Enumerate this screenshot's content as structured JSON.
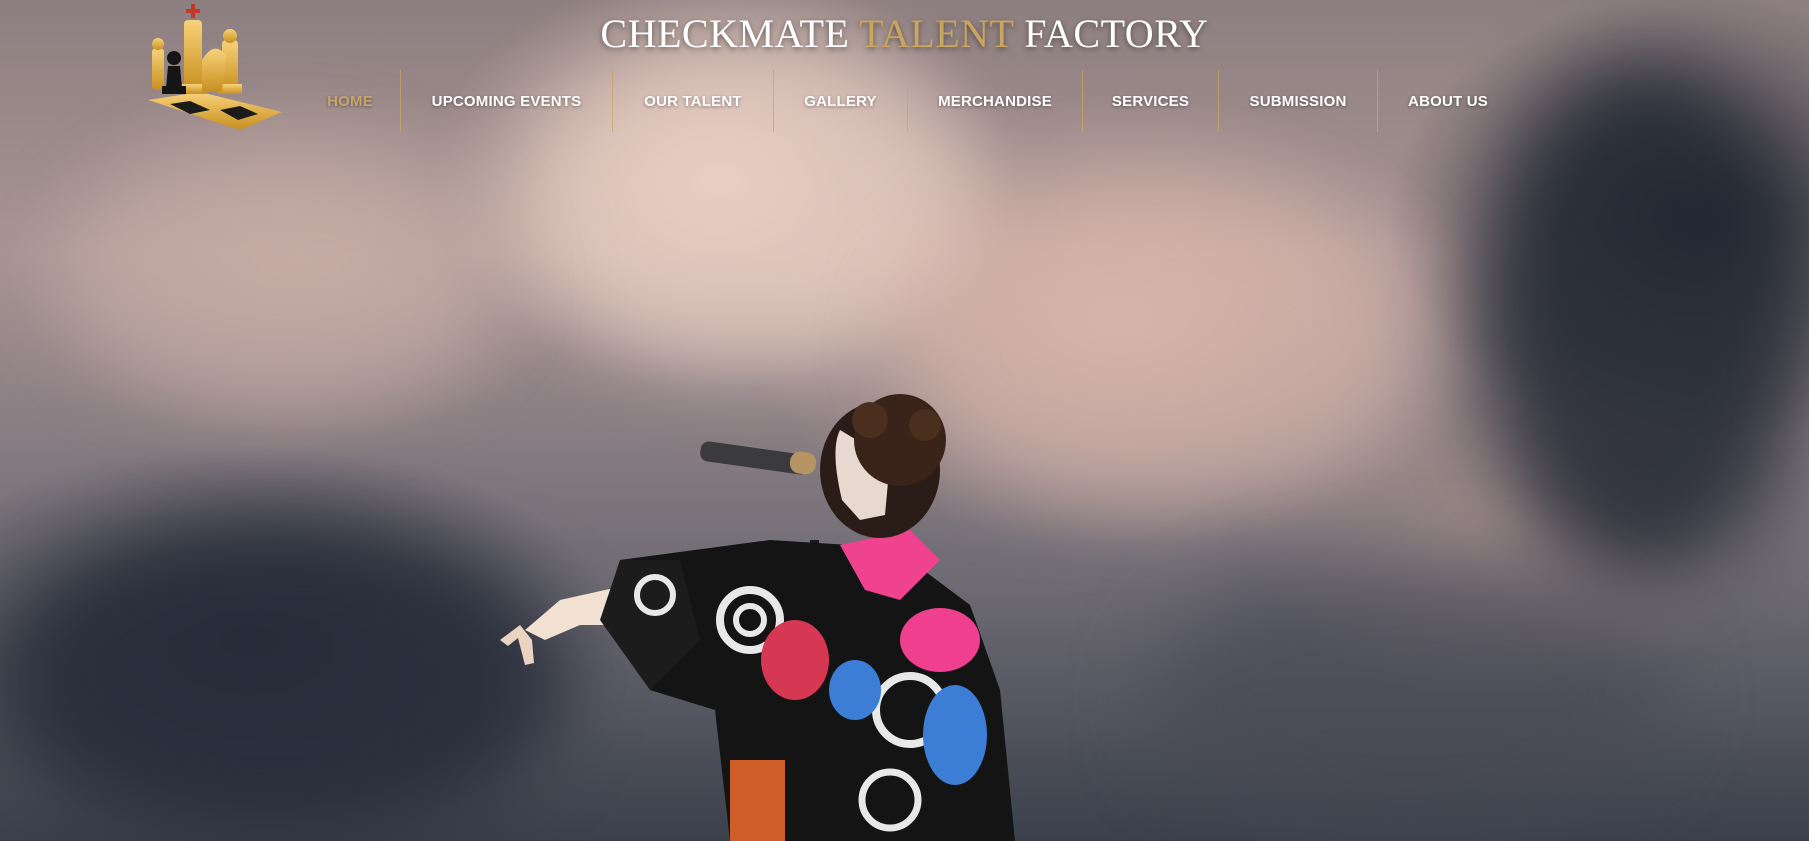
{
  "header": {
    "title_part1": "CHECKMATE ",
    "title_accent": "TALENT",
    "title_part2": " FACTORY",
    "accent_color": "#c9a55f",
    "logo_icon": "chess-pieces-logo-icon"
  },
  "nav": {
    "items": [
      {
        "label": "HOME",
        "active": true
      },
      {
        "label": "UPCOMING EVENTS",
        "active": false
      },
      {
        "label": "OUR TALENT",
        "active": false
      },
      {
        "label": "GALLERY",
        "active": false
      },
      {
        "label": "MERCHANDISE",
        "active": false
      },
      {
        "label": "SERVICES",
        "active": false
      },
      {
        "label": "SUBMISSION",
        "active": false
      },
      {
        "label": "ABOUT US",
        "active": false
      }
    ],
    "active_color": "#c7a56a",
    "separator_color": "#c9a55f"
  },
  "hero": {
    "image_subject": "performer-singing-into-microphone"
  }
}
